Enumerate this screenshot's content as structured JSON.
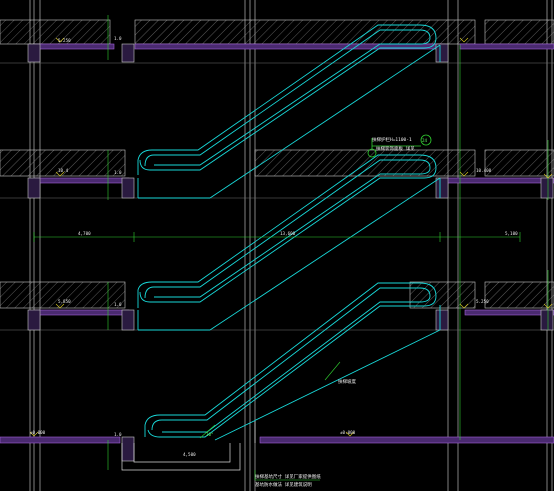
{
  "drawing": {
    "colors": {
      "background": "#000000",
      "escalator": "#18d7d7",
      "slab_hatch": "#c8c8c8",
      "floor_finish": "#9050c0",
      "grid": "#d8d8d8",
      "dimension": "#30d030",
      "marker": "#e0d020",
      "callout": "#30d030"
    },
    "floors": [
      {
        "level_label": "5.250",
        "slab_tag": "1.0"
      },
      {
        "level_label": "10.4",
        "slab_tag": "1.0"
      },
      {
        "level_label": "5.850",
        "slab_tag": "1.0"
      },
      {
        "level_label": "±0.000",
        "slab_tag": "1.0"
      }
    ],
    "notes": {
      "callout_line1": "扶梯护栏H=1100-1",
      "callout_line2": "扶梯装饰面板 详见",
      "callout_tag": "24",
      "incline_note": "扶梯坡度",
      "angle_label": "30°",
      "bottom_note_line1": "扶梯基坑尺寸 详见厂家提供图纸",
      "bottom_note_line2": "基坑防水做法 详见建筑说明",
      "bottom_dim": "4,500"
    },
    "dimensions": {
      "mid_left": "4,700",
      "mid_center": "13,600",
      "mid_right": "5,100",
      "right_level_a": "±0.000",
      "right_level_b": "5.250",
      "right_level_c": "10.400"
    }
  }
}
